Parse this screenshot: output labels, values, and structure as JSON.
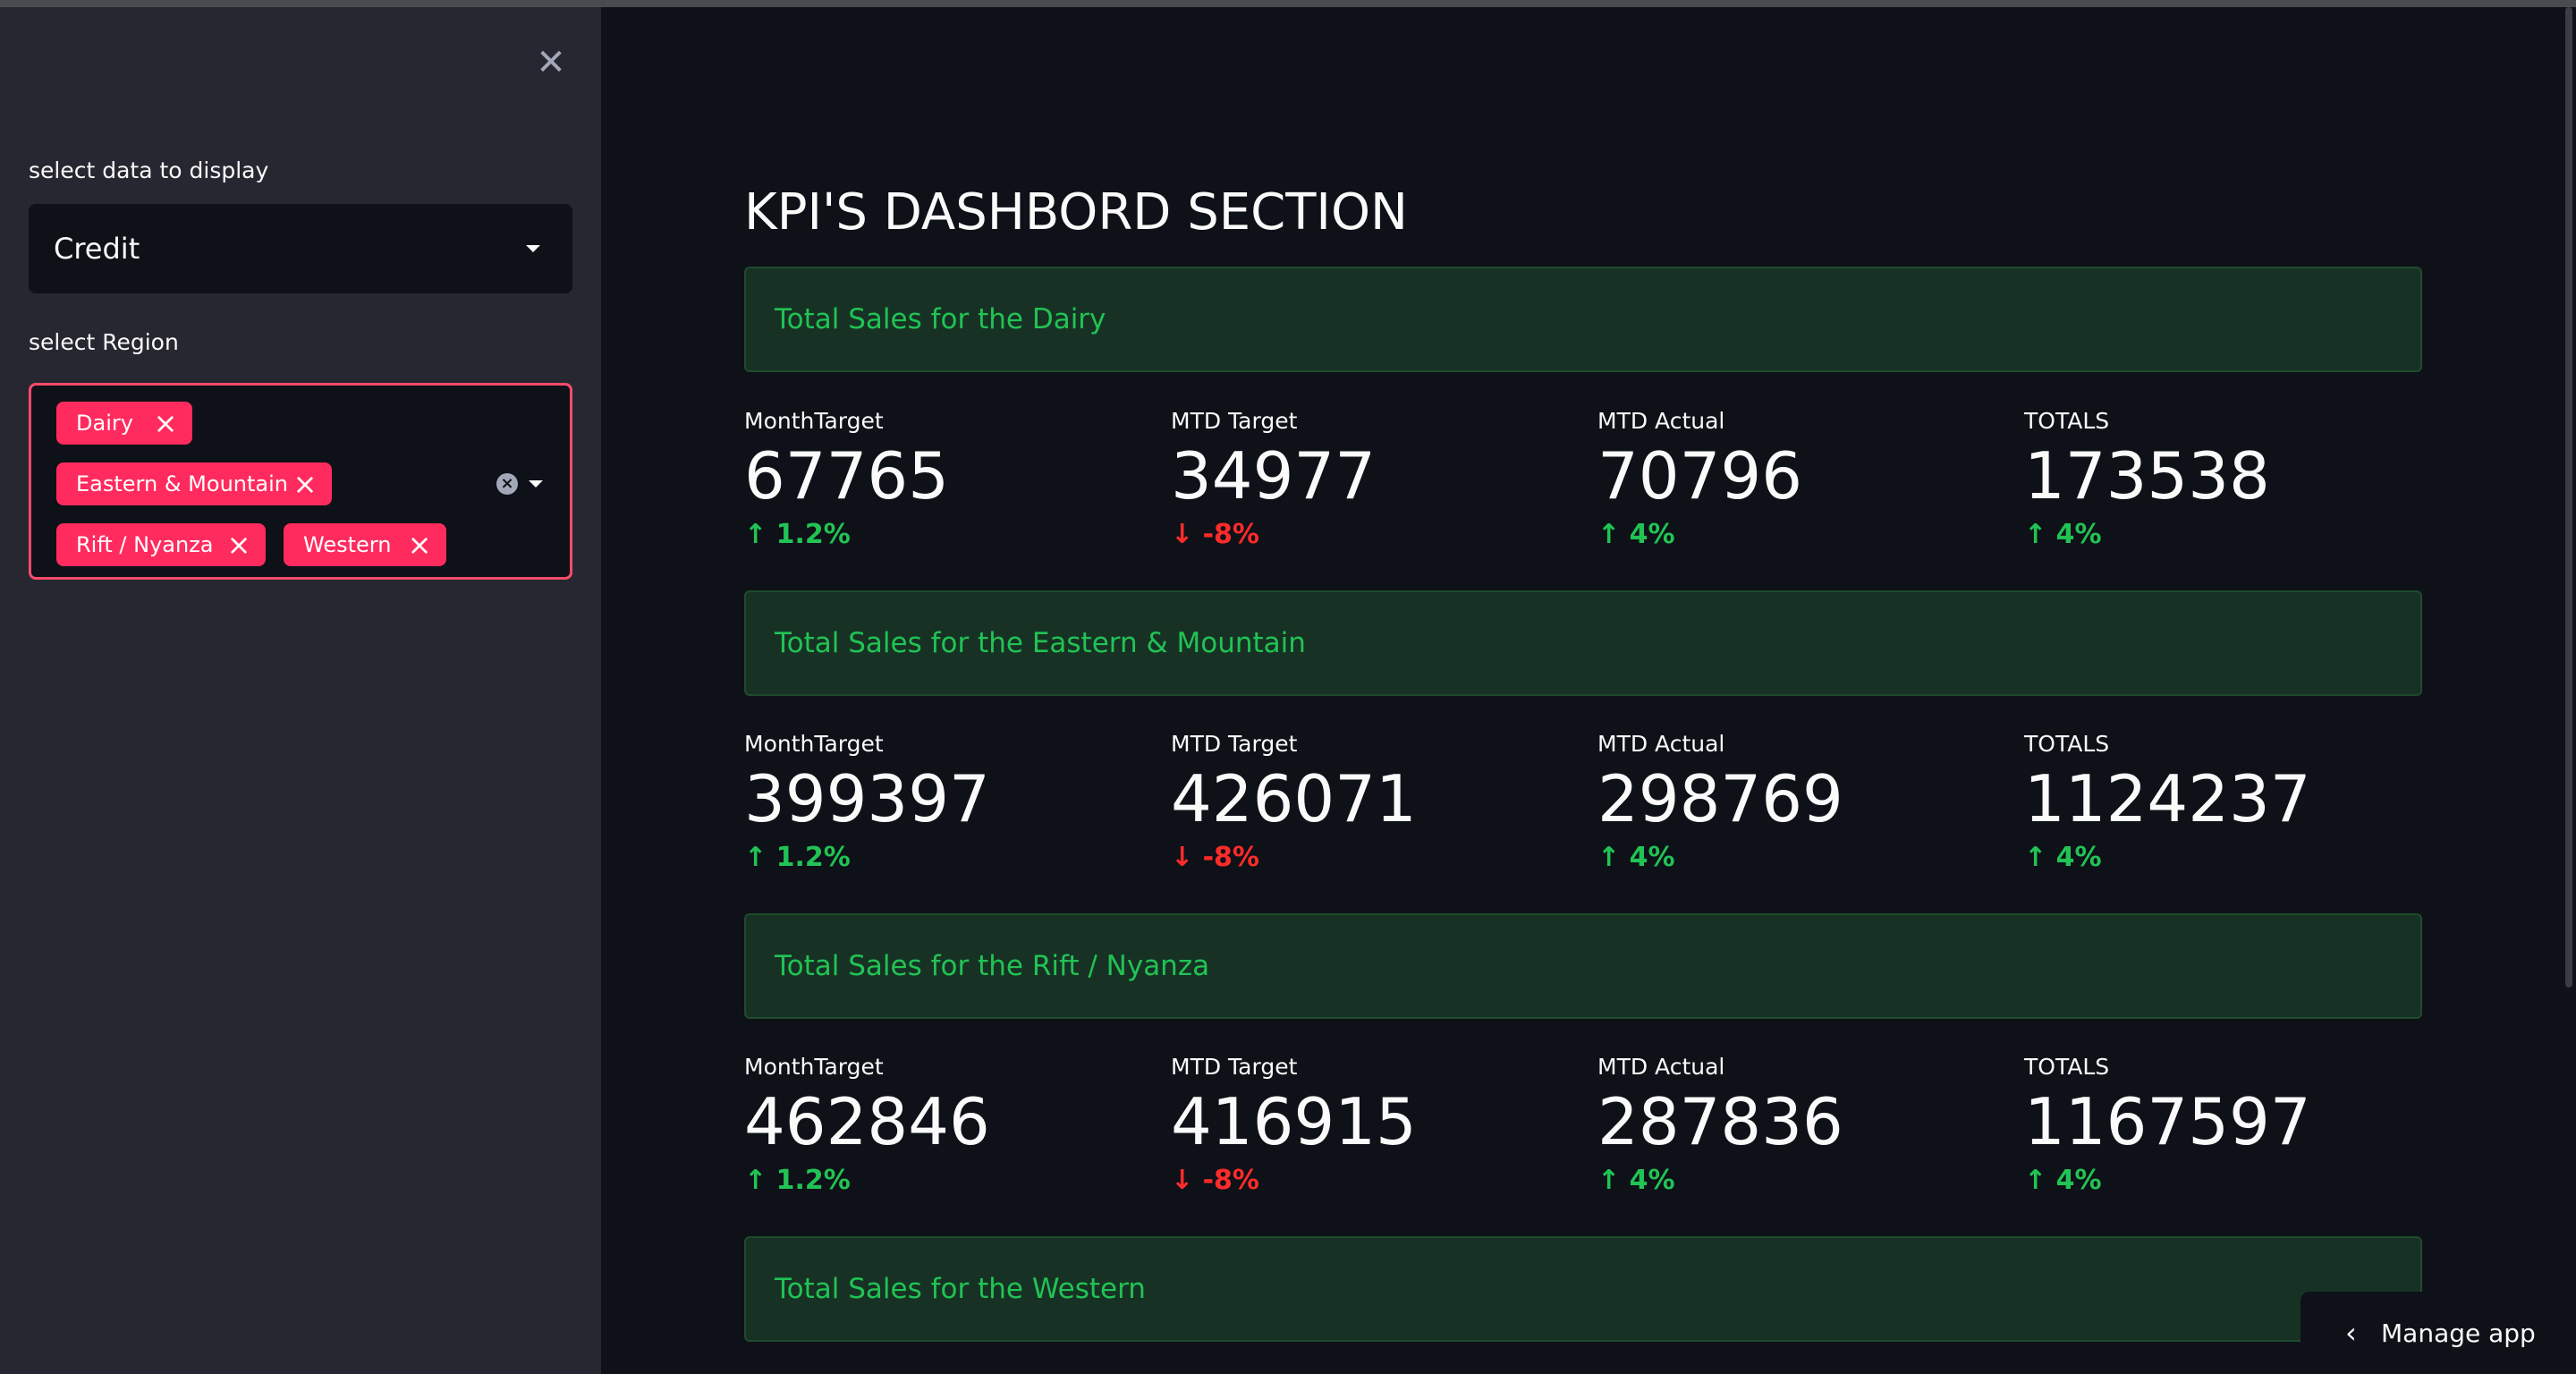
{
  "sidebar": {
    "close_icon": "close-icon",
    "data_label": "select data to display",
    "data_value": "Credit",
    "region_label": "select Region",
    "region_tags": [
      "Dairy",
      "Eastern & Mountain",
      "Rift / Nyanza",
      "Western"
    ]
  },
  "main": {
    "title": "KPI'S DASHBORD SECTION",
    "sections": [
      {
        "title": "Total Sales for the Dairy",
        "metrics": [
          {
            "label": "MonthTarget",
            "value": "67765",
            "delta": "↑ 1.2%",
            "direction": "up"
          },
          {
            "label": "MTD Target",
            "value": "34977",
            "delta": "↓ -8%",
            "direction": "down"
          },
          {
            "label": "MTD Actual",
            "value": "70796",
            "delta": "↑ 4%",
            "direction": "up"
          },
          {
            "label": "TOTALS",
            "value": "173538",
            "delta": "↑ 4%",
            "direction": "up"
          }
        ]
      },
      {
        "title": "Total Sales for the Eastern & Mountain",
        "metrics": [
          {
            "label": "MonthTarget",
            "value": "399397",
            "delta": "↑ 1.2%",
            "direction": "up"
          },
          {
            "label": "MTD Target",
            "value": "426071",
            "delta": "↓ -8%",
            "direction": "down"
          },
          {
            "label": "MTD Actual",
            "value": "298769",
            "delta": "↑ 4%",
            "direction": "up"
          },
          {
            "label": "TOTALS",
            "value": "1124237",
            "delta": "↑ 4%",
            "direction": "up"
          }
        ]
      },
      {
        "title": "Total Sales for the Rift / Nyanza",
        "metrics": [
          {
            "label": "MonthTarget",
            "value": "462846",
            "delta": "↑ 1.2%",
            "direction": "up"
          },
          {
            "label": "MTD Target",
            "value": "416915",
            "delta": "↓ -8%",
            "direction": "down"
          },
          {
            "label": "MTD Actual",
            "value": "287836",
            "delta": "↑ 4%",
            "direction": "up"
          },
          {
            "label": "TOTALS",
            "value": "1167597",
            "delta": "↑ 4%",
            "direction": "up"
          }
        ]
      },
      {
        "title": "Total Sales for the Western"
      }
    ]
  },
  "footer": {
    "manage_label": "Manage app"
  },
  "colors": {
    "accent": "#ff2b5e",
    "positive": "#21c354",
    "negative": "#ff2b2b",
    "background": "#0e1117",
    "sidebar": "#262730"
  }
}
